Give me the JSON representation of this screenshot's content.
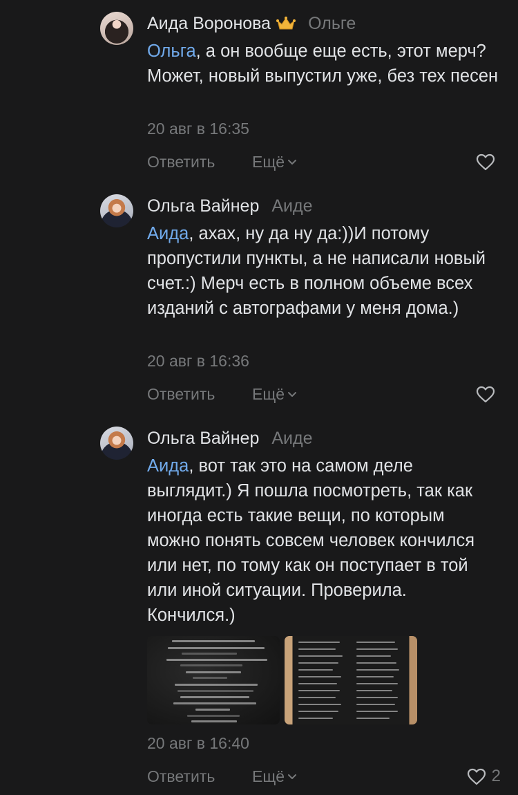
{
  "comments": [
    {
      "author": "Аида Воронова",
      "has_crown": true,
      "reply_to": "Ольге",
      "mention": "Ольга",
      "text": ", а он вообще еще есть, этот мерч? Может, новый выпустил уже, без тех песен",
      "date": "20 авг в 16:35",
      "reply_label": "Ответить",
      "more_label": "Ещё",
      "likes": ""
    },
    {
      "author": "Ольга Вайнер",
      "reply_to": "Аиде",
      "mention": "Аида",
      "text": ", ахах, ну да ну да:))И потому пропустили пункты, а не написали новый счет.:) Мерч есть в полном объеме всех изданий с автографами у меня дома.)",
      "date": "20 авг в 16:36",
      "reply_label": "Ответить",
      "more_label": "Ещё",
      "likes": ""
    },
    {
      "author": "Ольга Вайнер",
      "reply_to": "Аиде",
      "mention": "Аида",
      "text": ", вот так это на самом деле выглядит.) Я пошла посмотреть, так как иногда есть такие вещи, по которым можно понять совсем человек кончился или нет, по тому как он поступает в той или иной ситуации. Проверила. Кончился.)",
      "date": "20 авг в 16:40",
      "reply_label": "Ответить",
      "more_label": "Ещё",
      "likes": "2"
    }
  ],
  "colors": {
    "background": "#19191a",
    "text": "#e1e3e6",
    "secondary": "#76787a",
    "mention": "#71aaeb"
  },
  "icons": [
    "crown-icon",
    "chevron-down-icon",
    "heart-icon"
  ]
}
